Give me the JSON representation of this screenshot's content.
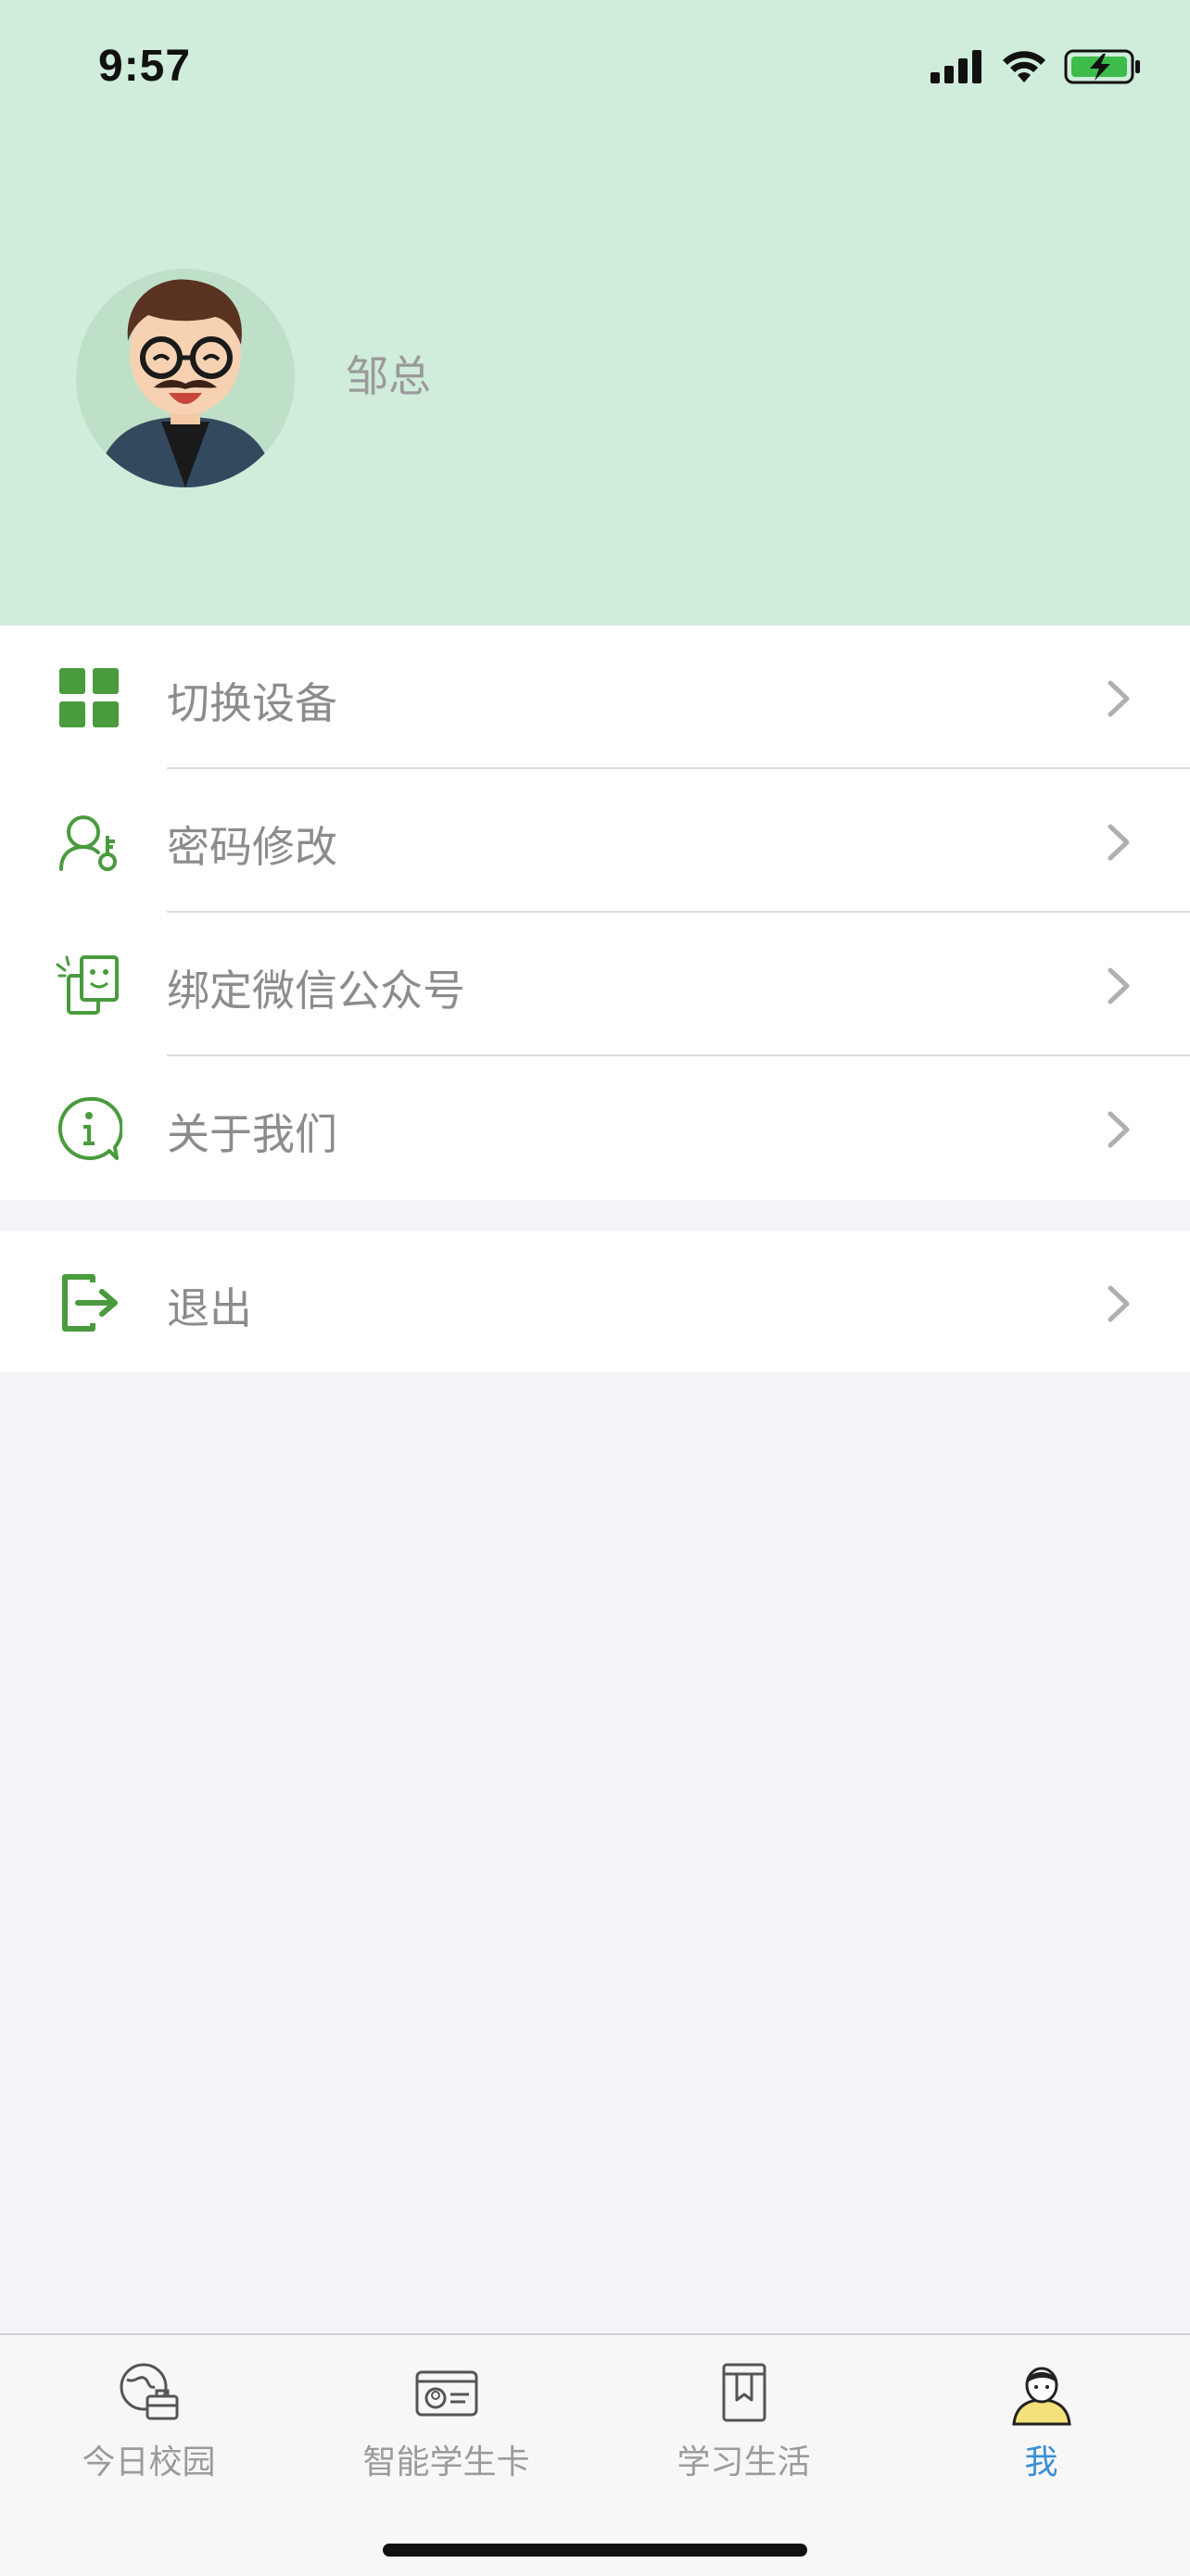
{
  "status_bar": {
    "time": "9:57"
  },
  "profile": {
    "name": "邹总"
  },
  "menu": {
    "items": [
      {
        "label": "切换设备",
        "icon": "grid-icon"
      },
      {
        "label": "密码修改",
        "icon": "user-key-icon"
      },
      {
        "label": "绑定微信公众号",
        "icon": "wechat-bind-icon"
      },
      {
        "label": "关于我们",
        "icon": "info-icon"
      }
    ],
    "logout": {
      "label": "退出",
      "icon": "logout-icon"
    }
  },
  "tabbar": {
    "tabs": [
      {
        "label": "今日校园",
        "icon": "campus-icon",
        "active": false
      },
      {
        "label": "智能学生卡",
        "icon": "student-card-icon",
        "active": false
      },
      {
        "label": "学习生活",
        "icon": "book-icon",
        "active": false
      },
      {
        "label": "我",
        "icon": "profile-icon",
        "active": true
      }
    ]
  },
  "colors": {
    "header_bg": "#d0ecda",
    "accent_green": "#4a9a3e",
    "active_tab": "#3a8fd6"
  }
}
